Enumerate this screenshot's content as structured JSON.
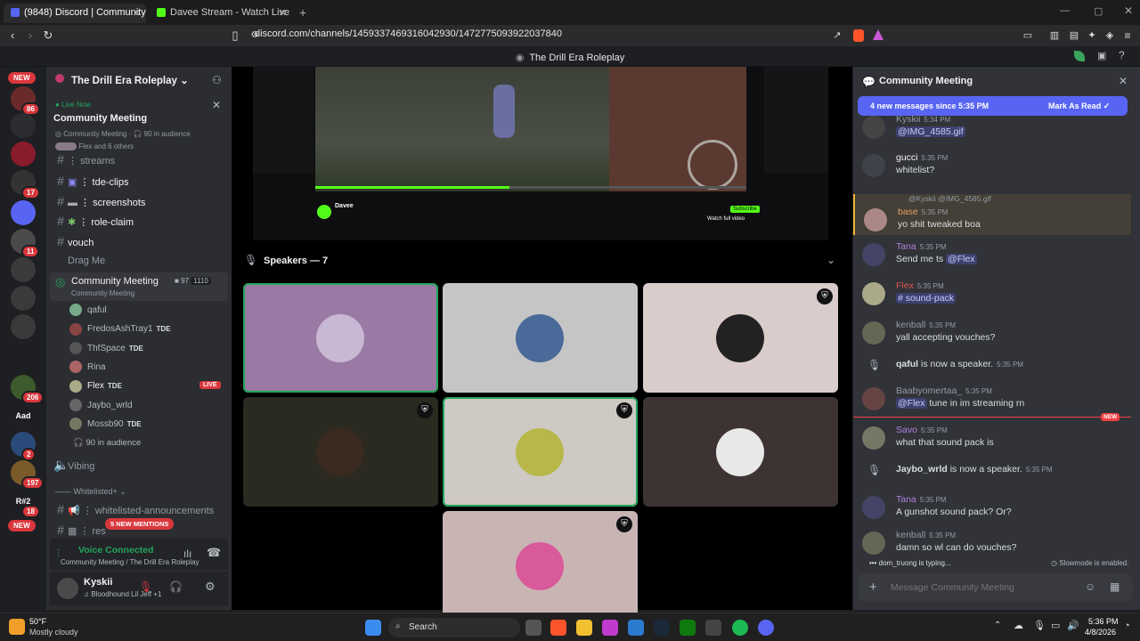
{
  "browser": {
    "tabs": [
      {
        "label": "(9848) Discord | Community M",
        "active": true
      },
      {
        "label": "Davee Stream - Watch Live on Ki",
        "active": false
      }
    ],
    "url": "discord.com/channels/1459337469316042930/1472775093922037840",
    "window_title": "The Drill Era Roleplay"
  },
  "rail": {
    "new_top": "NEW",
    "new_bottom": "NEW",
    "servers": [
      {
        "label": "",
        "badge": "86",
        "color": "#6b2a2a"
      },
      {
        "label": "",
        "badge": "",
        "color": "#2b2d31"
      },
      {
        "label": "",
        "badge": "",
        "color": "#8a1b2c"
      },
      {
        "label": "",
        "badge": "17",
        "color": "#333"
      },
      {
        "label": "",
        "badge": "",
        "color": "#5865f2"
      },
      {
        "label": "",
        "badge": "11",
        "color": "#4a4a4a"
      },
      {
        "label": "",
        "badge": "",
        "color": "#3a3a3a"
      },
      {
        "label": "",
        "badge": "",
        "color": "#3a3a3a"
      },
      {
        "label": "",
        "badge": "",
        "color": "#3a3a3a"
      },
      {
        "label": "",
        "badge": "",
        "color": "#1e1f22"
      },
      {
        "label": "",
        "badge": "206",
        "color": "#3c5a2b"
      },
      {
        "label": "Aad",
        "badge": "",
        "color": "#1e1f22"
      },
      {
        "label": "",
        "badge": "2",
        "color": "#2a4a7a"
      },
      {
        "label": "",
        "badge": "197",
        "color": "#7a5a2a"
      },
      {
        "label": "R#2",
        "badge": "18",
        "color": "#1e1f22"
      }
    ]
  },
  "sidebar": {
    "server_name": "The Drill Era Roleplay",
    "live_now": "Live Now",
    "live_title": "Community Meeting",
    "live_sub": "Community Meeting",
    "live_audience": "90 in audience",
    "live_viewers": "Flex and 6 others",
    "channels": [
      {
        "name": "streams",
        "icon": "hash",
        "bright": false
      },
      {
        "name": "tde-clips",
        "icon": "hash",
        "bright": true
      },
      {
        "name": "screenshots",
        "icon": "hash",
        "bright": true
      },
      {
        "name": "role-claim",
        "icon": "hash",
        "bright": true
      },
      {
        "name": "vouch",
        "icon": "hash",
        "bright": true
      },
      {
        "name": "Drag Me",
        "icon": "none",
        "bright": false
      }
    ],
    "stage": {
      "name": "Community Meeting",
      "topic": "Community Meeting",
      "cam_count": "97",
      "listeners": "1110"
    },
    "users": [
      {
        "name": "qaful",
        "tag": "",
        "live": false,
        "color": "#7a8"
      },
      {
        "name": "FredosAshTray1",
        "tag": "TDE",
        "live": false,
        "color": "#844"
      },
      {
        "name": "ThfSpace",
        "tag": "TDE",
        "live": false,
        "color": "#555"
      },
      {
        "name": "Rina",
        "tag": "",
        "live": false,
        "color": "#a66"
      },
      {
        "name": "Flex",
        "tag": "TDE",
        "live": true,
        "color": "#aa8"
      },
      {
        "name": "Jaybo_wrld",
        "tag": "",
        "live": false,
        "color": "#666"
      },
      {
        "name": "Mossb90",
        "tag": "TDE",
        "live": false,
        "color": "#776"
      }
    ],
    "live_badge": "LIVE",
    "audience": "90 in audience",
    "vibing": "Vibing",
    "whitelisted_header": "Whitelisted+",
    "whitelisted_announcements": "whitelisted-announcements",
    "res_channel": "res",
    "new_mentions": "5 NEW MENTIONS"
  },
  "voice": {
    "status": "Voice Connected",
    "location": "Community Meeting / The Drill Era Roleplay"
  },
  "account": {
    "name": "Kyskii",
    "status": "Bloodhound Lil Jeff +1"
  },
  "stream": {
    "streamer": "Davee",
    "subscribe": "Subscribe",
    "watch": "Watch full video"
  },
  "speakers": {
    "label": "Speakers — 7",
    "tiles": [
      {
        "bg": "#9a7aa4",
        "av": "#c9b8d4",
        "shield": false,
        "speaking": true
      },
      {
        "bg": "#c5c5c5",
        "av": "#4a6a9a",
        "shield": false,
        "speaking": false
      },
      {
        "bg": "#d9cccb",
        "av": "#222",
        "shield": true,
        "speaking": false
      },
      {
        "bg": "#2a2a20",
        "av": "#3a2a20",
        "shield": true,
        "speaking": false
      },
      {
        "bg": "#cfc9c4",
        "av": "#b8b84a",
        "shield": true,
        "speaking": true
      },
      {
        "bg": "#3d3333",
        "av": "#e8e8e8",
        "shield": false,
        "speaking": false
      },
      {
        "bg": "#c9b4b4",
        "av": "#d85a9a",
        "shield": true,
        "speaking": false
      }
    ]
  },
  "chat": {
    "title": "Community Meeting",
    "banner": "4 new messages since 5:35 PM",
    "mark_read": "Mark As Read",
    "new_label": "NEW",
    "typing": "dom_truong is typing...",
    "slowmode": "Slowmode is enabled.",
    "placeholder": "Message Community Meeting",
    "messages": [
      {
        "name": "Kyskii",
        "time": "5:34 PM",
        "text": "@IMG_4585.gif",
        "name_color": "#949ba4",
        "mention": true,
        "av": "#444"
      },
      {
        "name": "gucci",
        "time": "5:35 PM",
        "text": "whitelist?",
        "name_color": "#f2f3f5",
        "mention": false,
        "av": "#404249"
      },
      {
        "name": "base",
        "time": "5:35 PM",
        "text": "yo shit tweaked boa",
        "name_color": "#e0a060",
        "mention": false,
        "av": "#a88",
        "reply": "@Kyskii @IMG_4585.gif"
      },
      {
        "name": "Tana",
        "time": "5:35 PM",
        "text": "Send me ts",
        "mention_text": "@Flex",
        "name_color": "#b07fdc",
        "mention": false,
        "av": "#446"
      },
      {
        "name": "Flex",
        "time": "5:35 PM",
        "text": "# sound-pack",
        "name_color": "#e0564a",
        "mention": true,
        "av": "#aa8"
      },
      {
        "name": "kenball",
        "time": "5:35 PM",
        "text": "yall accepting vouches?",
        "name_color": "#949ba4",
        "mention": false,
        "av": "#665"
      },
      {
        "name": "qaful",
        "time": "5:35 PM",
        "text": "is now a speaker.",
        "name_color": "#dbdee1",
        "mention": false,
        "system": true
      },
      {
        "name": "Baabyomertaa_",
        "time": "5:35 PM",
        "text": "tune in im streaming rn",
        "mention_text": "@Flex",
        "name_color": "#949ba4",
        "mention": false,
        "av": "#644"
      },
      {
        "name": "Savo",
        "time": "5:35 PM",
        "text": "what that sound pack is",
        "name_color": "#b07fdc",
        "mention": false,
        "av": "#776"
      },
      {
        "name": "Jaybo_wrld",
        "time": "5:35 PM",
        "text": "is now a speaker.",
        "name_color": "#dbdee1",
        "mention": false,
        "system": true
      },
      {
        "name": "Tana",
        "time": "5:35 PM",
        "text": "A gunshot sound  pack? Or?",
        "name_color": "#b07fdc",
        "mention": false,
        "av": "#446"
      },
      {
        "name": "kenball",
        "time": "5:35 PM",
        "text": "damn so wl can do vouches?",
        "name_color": "#949ba4",
        "mention": false,
        "av": "#665"
      }
    ]
  },
  "taskbar": {
    "temp": "50°F",
    "weather": "Mostly cloudy",
    "search": "Search",
    "time": "5:36 PM",
    "date": "4/8/2026"
  }
}
